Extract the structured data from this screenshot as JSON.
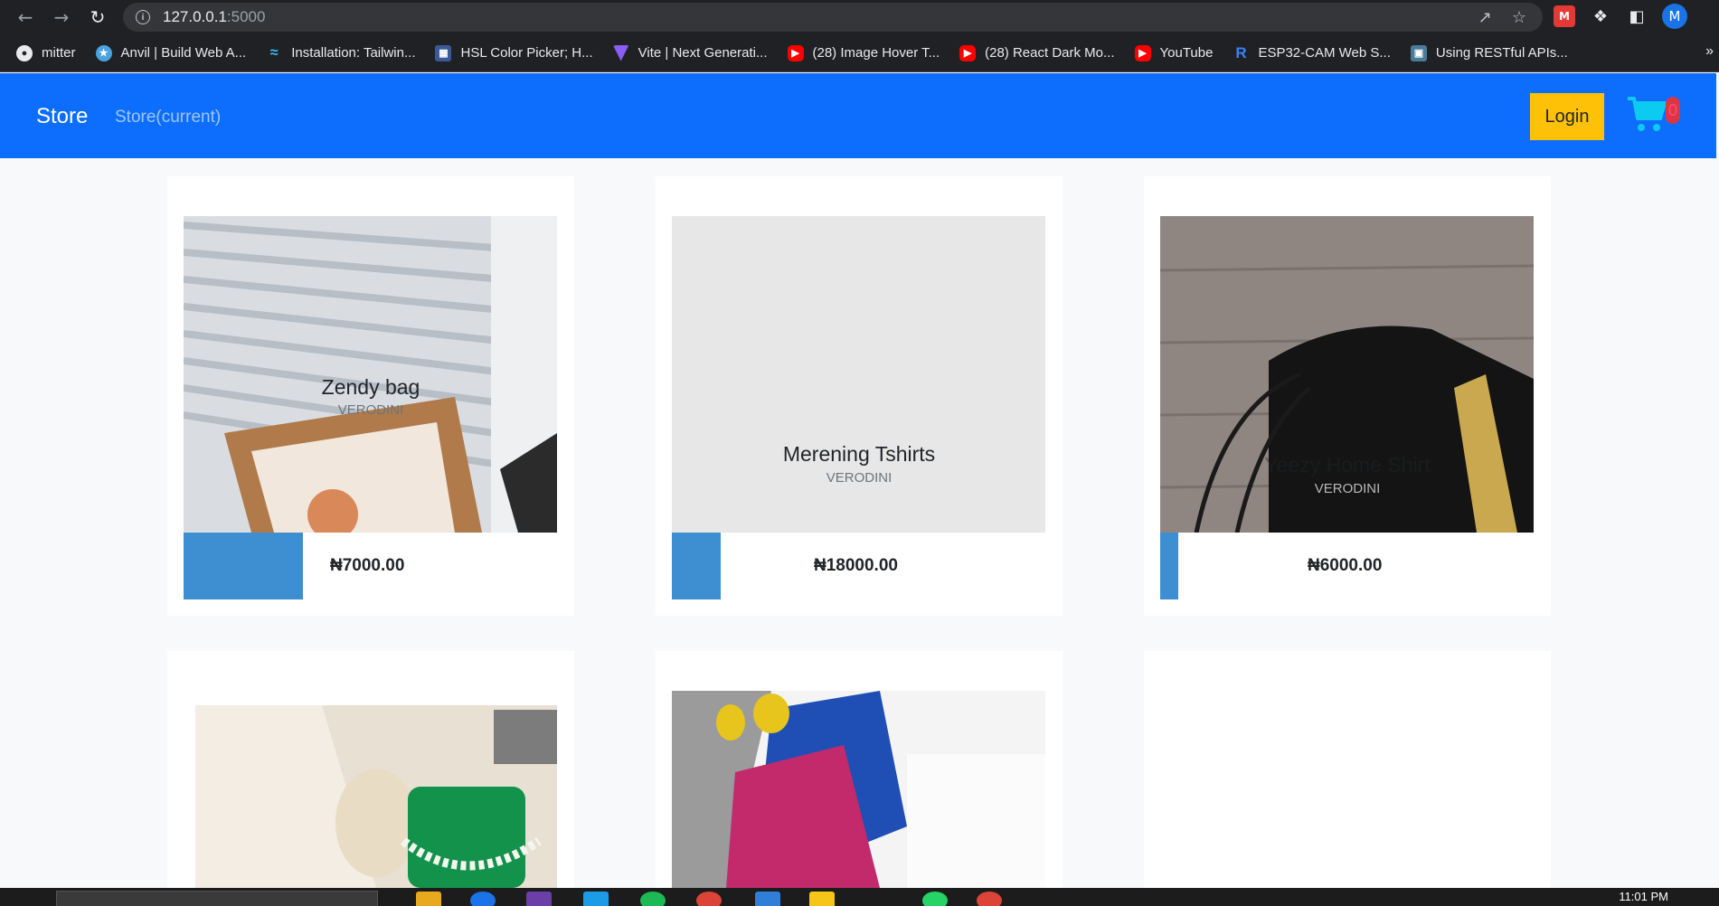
{
  "browser": {
    "url_host": "127.0.0.1",
    "url_port": ":5000",
    "profile_initial": "M",
    "bookmarks": [
      {
        "label": "mitter",
        "icon": "globe-icon"
      },
      {
        "label": "Anvil | Build Web A...",
        "icon": "anvil-icon"
      },
      {
        "label": "Installation: Tailwin...",
        "icon": "tailwind-icon"
      },
      {
        "label": "HSL Color Picker; H...",
        "icon": "hsl-icon"
      },
      {
        "label": "Vite | Next Generati...",
        "icon": "vite-icon"
      },
      {
        "label": "(28) Image Hover T...",
        "icon": "youtube-icon"
      },
      {
        "label": "(28) React Dark Mo...",
        "icon": "youtube-icon"
      },
      {
        "label": "YouTube",
        "icon": "youtube-icon"
      },
      {
        "label": "ESP32-CAM Web S...",
        "icon": "r-icon"
      },
      {
        "label": "Using RESTful APIs...",
        "icon": "rest-icon"
      }
    ]
  },
  "navbar": {
    "brand": "Store",
    "link": "Store(current)",
    "login_label": "Login",
    "cart_count": "0"
  },
  "products": [
    {
      "title": "Zendy bag",
      "brand": "VERODINI",
      "price": "₦7000.00"
    },
    {
      "title": "Merening Tshirts",
      "brand": "VERODINI",
      "price": "₦18000.00"
    },
    {
      "title": "Yeezy Home Shirt",
      "brand": "VERODINI",
      "price": "₦6000.00"
    }
  ],
  "taskbar": {
    "clock": "11:01 PM"
  },
  "colors": {
    "navbar": "#0d6efd",
    "login": "#ffc107",
    "add_button": "#3d8fd1",
    "cart": "#0dcaf0"
  }
}
